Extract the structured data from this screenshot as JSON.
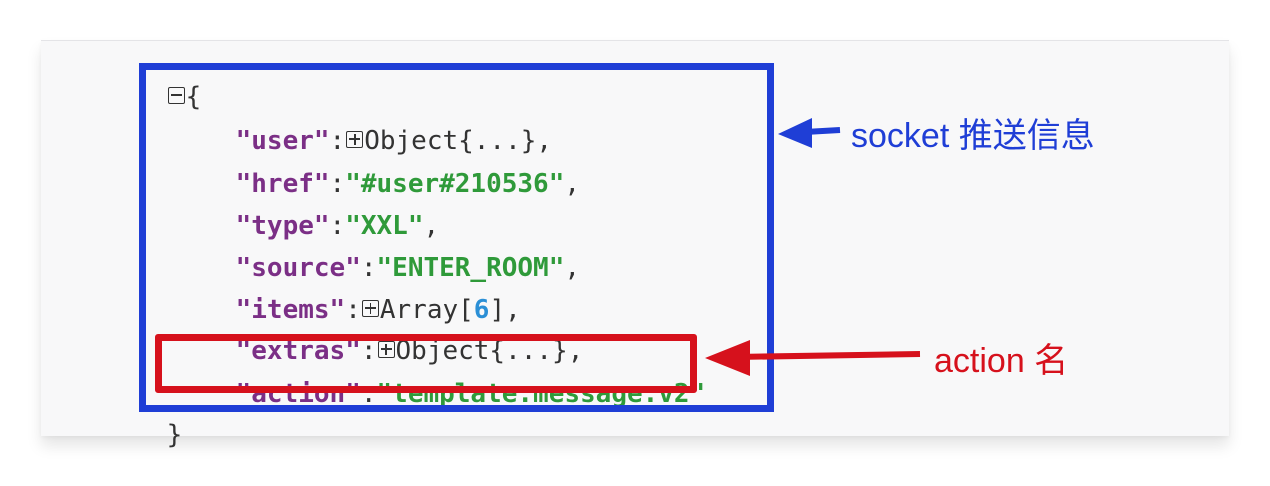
{
  "json_viewer": {
    "open_brace": "{",
    "close_brace": "}",
    "entries": [
      {
        "key": "\"user\"",
        "colon": ":",
        "value_type": "Object{...}",
        "trail": ","
      },
      {
        "key": "\"href\"",
        "colon": ":",
        "value": "\"#user#210536\"",
        "trail": ","
      },
      {
        "key": "\"type\"",
        "colon": ":",
        "value": "\"XXL\"",
        "trail": ","
      },
      {
        "key": "\"source\"",
        "colon": ":",
        "value": "\"ENTER_ROOM\"",
        "trail": ","
      },
      {
        "key": "\"items\"",
        "colon": ":",
        "value_type": "Array[",
        "count": "6",
        "value_close": "]",
        "trail": ","
      },
      {
        "key": "\"extras\"",
        "colon": ":",
        "value_type": "Object{...}",
        "trail": ","
      },
      {
        "key": "\"action\"",
        "colon": ":",
        "value": "\"template.message.v2\"",
        "trail": ""
      }
    ]
  },
  "annotations": {
    "socket_label": "socket 推送信息",
    "action_label": "action 名"
  },
  "colors": {
    "key": "#7b2f86",
    "string": "#2f9a3a",
    "number": "#2b8fd6",
    "blue_highlight": "#1f3ed6",
    "red_highlight": "#d6111c"
  },
  "icons": [
    "collapse-toggle-icon",
    "expand-toggle-icon",
    "arrow-left-icon"
  ]
}
